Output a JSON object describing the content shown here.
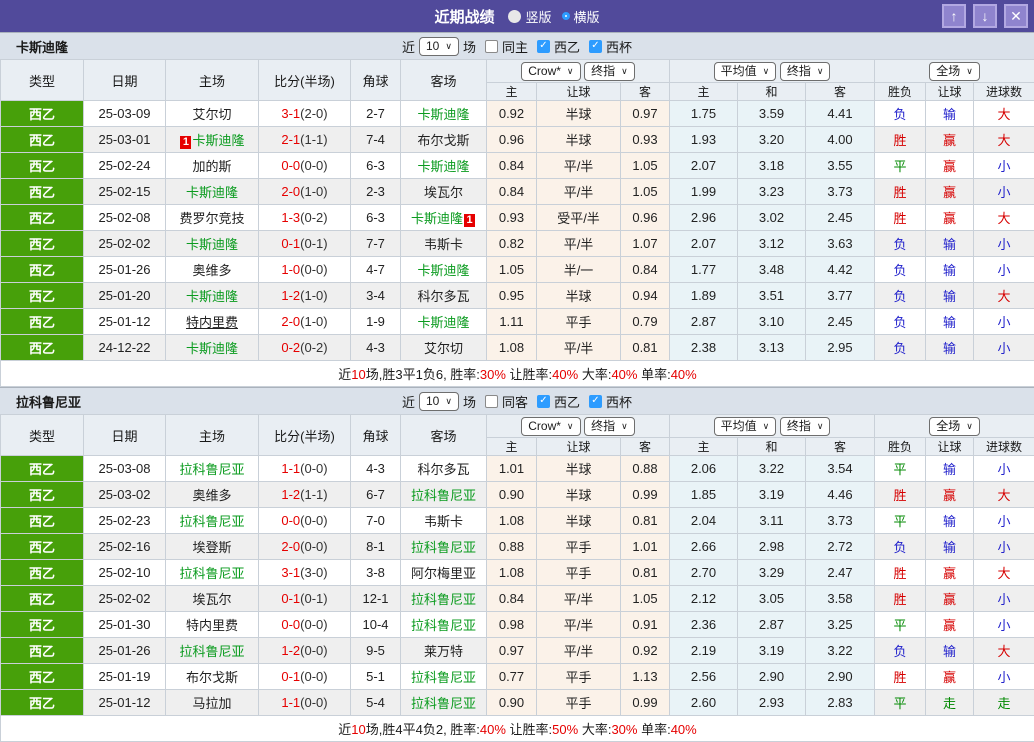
{
  "titlebar": {
    "title": "近期战绩",
    "vertical_label": "竖版",
    "horizontal_label": "横版",
    "up_icon": "↑",
    "down_icon": "↓",
    "close_icon": "✕",
    "bg_color": "#514A9B"
  },
  "dropdowns": {
    "source": "Crow*",
    "source_time": "终指",
    "avg": "平均值",
    "avg_time": "终指",
    "scope": "全场"
  },
  "table_columns": {
    "left": [
      "类型",
      "日期",
      "主场",
      "比分(半场)",
      "角球",
      "客场"
    ],
    "sub": [
      "主",
      "让球",
      "客",
      "主",
      "和",
      "客",
      "胜负",
      "让球",
      "进球数"
    ]
  },
  "result_colors": {
    "胜": "#D60000",
    "赢": "#D60000",
    "大": "#D60000",
    "负": "#2222CC",
    "输": "#2222CC",
    "小": "#2222CC",
    "平": "#008800",
    "走": "#008800"
  },
  "colors": {
    "league_green": "#47A00A",
    "team_green": "#0A9B1E",
    "score_red": "#E60000"
  },
  "sections": [
    {
      "team": "卡斯迪隆",
      "filter": {
        "prefix": "近",
        "count": "10",
        "suffix": "场",
        "checks": [
          {
            "label": "同主",
            "checked": false
          },
          {
            "label": "西乙",
            "checked": true
          },
          {
            "label": "西杯",
            "checked": true
          }
        ]
      },
      "rows": [
        {
          "type": "西乙",
          "date": "25-03-09",
          "home": {
            "name": "艾尔切"
          },
          "score": "3-1",
          "half": "(2-0)",
          "corner": "2-7",
          "away": {
            "name": "卡斯迪隆",
            "green": true
          },
          "odds": [
            "0.92",
            "半球",
            "0.97"
          ],
          "avg": [
            "1.75",
            "3.59",
            "4.41"
          ],
          "results": [
            "负",
            "输",
            "大"
          ]
        },
        {
          "type": "西乙",
          "date": "25-03-01",
          "home": {
            "name": "卡斯迪隆",
            "green": true,
            "badge": "1",
            "badge_pos": "before"
          },
          "score": "2-1",
          "half": "(1-1)",
          "corner": "7-4",
          "away": {
            "name": "布尔戈斯"
          },
          "odds": [
            "0.96",
            "半球",
            "0.93"
          ],
          "avg": [
            "1.93",
            "3.20",
            "4.00"
          ],
          "results": [
            "胜",
            "赢",
            "大"
          ]
        },
        {
          "type": "西乙",
          "date": "25-02-24",
          "home": {
            "name": "加的斯"
          },
          "score": "0-0",
          "half": "(0-0)",
          "corner": "6-3",
          "away": {
            "name": "卡斯迪隆",
            "green": true
          },
          "odds": [
            "0.84",
            "平/半",
            "1.05"
          ],
          "avg": [
            "2.07",
            "3.18",
            "3.55"
          ],
          "results": [
            "平",
            "赢",
            "小"
          ]
        },
        {
          "type": "西乙",
          "date": "25-02-15",
          "home": {
            "name": "卡斯迪隆",
            "green": true
          },
          "score": "2-0",
          "half": "(1-0)",
          "corner": "2-3",
          "away": {
            "name": "埃瓦尔"
          },
          "odds": [
            "0.84",
            "平/半",
            "1.05"
          ],
          "avg": [
            "1.99",
            "3.23",
            "3.73"
          ],
          "results": [
            "胜",
            "赢",
            "小"
          ]
        },
        {
          "type": "西乙",
          "date": "25-02-08",
          "home": {
            "name": "费罗尔竞技"
          },
          "score": "1-3",
          "half": "(0-2)",
          "corner": "6-3",
          "away": {
            "name": "卡斯迪隆",
            "green": true,
            "badge": "1",
            "badge_pos": "after"
          },
          "odds": [
            "0.93",
            "受平/半",
            "0.96"
          ],
          "avg": [
            "2.96",
            "3.02",
            "2.45"
          ],
          "results": [
            "胜",
            "赢",
            "大"
          ]
        },
        {
          "type": "西乙",
          "date": "25-02-02",
          "home": {
            "name": "卡斯迪隆",
            "green": true
          },
          "score": "0-1",
          "half": "(0-1)",
          "corner": "7-7",
          "away": {
            "name": "韦斯卡"
          },
          "odds": [
            "0.82",
            "平/半",
            "1.07"
          ],
          "avg": [
            "2.07",
            "3.12",
            "3.63"
          ],
          "results": [
            "负",
            "输",
            "小"
          ]
        },
        {
          "type": "西乙",
          "date": "25-01-26",
          "home": {
            "name": "奥维多"
          },
          "score": "1-0",
          "half": "(0-0)",
          "corner": "4-7",
          "away": {
            "name": "卡斯迪隆",
            "green": true
          },
          "odds": [
            "1.05",
            "半/一",
            "0.84"
          ],
          "avg": [
            "1.77",
            "3.48",
            "4.42"
          ],
          "results": [
            "负",
            "输",
            "小"
          ]
        },
        {
          "type": "西乙",
          "date": "25-01-20",
          "home": {
            "name": "卡斯迪隆",
            "green": true
          },
          "score": "1-2",
          "half": "(1-0)",
          "corner": "3-4",
          "away": {
            "name": "科尔多瓦"
          },
          "odds": [
            "0.95",
            "半球",
            "0.94"
          ],
          "avg": [
            "1.89",
            "3.51",
            "3.77"
          ],
          "results": [
            "负",
            "输",
            "大"
          ]
        },
        {
          "type": "西乙",
          "date": "25-01-12",
          "home": {
            "name": "特内里费",
            "underline": true
          },
          "score": "2-0",
          "half": "(1-0)",
          "corner": "1-9",
          "away": {
            "name": "卡斯迪隆",
            "green": true
          },
          "odds": [
            "1.11",
            "平手",
            "0.79"
          ],
          "avg": [
            "2.87",
            "3.10",
            "2.45"
          ],
          "results": [
            "负",
            "输",
            "小"
          ]
        },
        {
          "type": "西乙",
          "date": "24-12-22",
          "home": {
            "name": "卡斯迪隆",
            "green": true
          },
          "score": "0-2",
          "half": "(0-2)",
          "corner": "4-3",
          "away": {
            "name": "艾尔切"
          },
          "odds": [
            "1.08",
            "平/半",
            "0.81"
          ],
          "avg": [
            "2.38",
            "3.13",
            "2.95"
          ],
          "results": [
            "负",
            "输",
            "小"
          ]
        }
      ],
      "summary": [
        {
          "t": "近"
        },
        {
          "t": "10",
          "red": true
        },
        {
          "t": "场,胜3平1负6, 胜率:"
        },
        {
          "t": "30%",
          "red": true
        },
        {
          "t": " 让胜率:"
        },
        {
          "t": "40%",
          "red": true
        },
        {
          "t": " 大率:"
        },
        {
          "t": "40%",
          "red": true
        },
        {
          "t": " 单率:"
        },
        {
          "t": "40%",
          "red": true
        }
      ]
    },
    {
      "team": "拉科鲁尼亚",
      "filter": {
        "prefix": "近",
        "count": "10",
        "suffix": "场",
        "checks": [
          {
            "label": "同客",
            "checked": false
          },
          {
            "label": "西乙",
            "checked": true
          },
          {
            "label": "西杯",
            "checked": true
          }
        ]
      },
      "rows": [
        {
          "type": "西乙",
          "date": "25-03-08",
          "home": {
            "name": "拉科鲁尼亚",
            "green": true
          },
          "score": "1-1",
          "half": "(0-0)",
          "corner": "4-3",
          "away": {
            "name": "科尔多瓦"
          },
          "odds": [
            "1.01",
            "半球",
            "0.88"
          ],
          "avg": [
            "2.06",
            "3.22",
            "3.54"
          ],
          "results": [
            "平",
            "输",
            "小"
          ]
        },
        {
          "type": "西乙",
          "date": "25-03-02",
          "home": {
            "name": "奥维多"
          },
          "score": "1-2",
          "half": "(1-1)",
          "corner": "6-7",
          "away": {
            "name": "拉科鲁尼亚",
            "green": true
          },
          "odds": [
            "0.90",
            "半球",
            "0.99"
          ],
          "avg": [
            "1.85",
            "3.19",
            "4.46"
          ],
          "results": [
            "胜",
            "赢",
            "大"
          ]
        },
        {
          "type": "西乙",
          "date": "25-02-23",
          "home": {
            "name": "拉科鲁尼亚",
            "green": true
          },
          "score": "0-0",
          "half": "(0-0)",
          "corner": "7-0",
          "away": {
            "name": "韦斯卡"
          },
          "odds": [
            "1.08",
            "半球",
            "0.81"
          ],
          "avg": [
            "2.04",
            "3.11",
            "3.73"
          ],
          "results": [
            "平",
            "输",
            "小"
          ]
        },
        {
          "type": "西乙",
          "date": "25-02-16",
          "home": {
            "name": "埃登斯"
          },
          "score": "2-0",
          "half": "(0-0)",
          "corner": "8-1",
          "away": {
            "name": "拉科鲁尼亚",
            "green": true
          },
          "odds": [
            "0.88",
            "平手",
            "1.01"
          ],
          "avg": [
            "2.66",
            "2.98",
            "2.72"
          ],
          "results": [
            "负",
            "输",
            "小"
          ]
        },
        {
          "type": "西乙",
          "date": "25-02-10",
          "home": {
            "name": "拉科鲁尼亚",
            "green": true
          },
          "score": "3-1",
          "half": "(3-0)",
          "corner": "3-8",
          "away": {
            "name": "阿尔梅里亚"
          },
          "odds": [
            "1.08",
            "平手",
            "0.81"
          ],
          "avg": [
            "2.70",
            "3.29",
            "2.47"
          ],
          "results": [
            "胜",
            "赢",
            "大"
          ]
        },
        {
          "type": "西乙",
          "date": "25-02-02",
          "home": {
            "name": "埃瓦尔"
          },
          "score": "0-1",
          "half": "(0-1)",
          "corner": "12-1",
          "away": {
            "name": "拉科鲁尼亚",
            "green": true
          },
          "odds": [
            "0.84",
            "平/半",
            "1.05"
          ],
          "avg": [
            "2.12",
            "3.05",
            "3.58"
          ],
          "results": [
            "胜",
            "赢",
            "小"
          ]
        },
        {
          "type": "西乙",
          "date": "25-01-30",
          "home": {
            "name": "特内里费"
          },
          "score": "0-0",
          "half": "(0-0)",
          "corner": "10-4",
          "away": {
            "name": "拉科鲁尼亚",
            "green": true
          },
          "odds": [
            "0.98",
            "平/半",
            "0.91"
          ],
          "avg": [
            "2.36",
            "2.87",
            "3.25"
          ],
          "results": [
            "平",
            "赢",
            "小"
          ]
        },
        {
          "type": "西乙",
          "date": "25-01-26",
          "home": {
            "name": "拉科鲁尼亚",
            "green": true
          },
          "score": "1-2",
          "half": "(0-0)",
          "corner": "9-5",
          "away": {
            "name": "莱万特"
          },
          "odds": [
            "0.97",
            "平/半",
            "0.92"
          ],
          "avg": [
            "2.19",
            "3.19",
            "3.22"
          ],
          "results": [
            "负",
            "输",
            "大"
          ]
        },
        {
          "type": "西乙",
          "date": "25-01-19",
          "home": {
            "name": "布尔戈斯"
          },
          "score": "0-1",
          "half": "(0-0)",
          "corner": "5-1",
          "away": {
            "name": "拉科鲁尼亚",
            "green": true
          },
          "odds": [
            "0.77",
            "平手",
            "1.13"
          ],
          "avg": [
            "2.56",
            "2.90",
            "2.90"
          ],
          "results": [
            "胜",
            "赢",
            "小"
          ]
        },
        {
          "type": "西乙",
          "date": "25-01-12",
          "home": {
            "name": "马拉加"
          },
          "score": "1-1",
          "half": "(0-0)",
          "corner": "5-4",
          "away": {
            "name": "拉科鲁尼亚",
            "green": true
          },
          "odds": [
            "0.90",
            "平手",
            "0.99"
          ],
          "avg": [
            "2.60",
            "2.93",
            "2.83"
          ],
          "results": [
            "平",
            "走",
            "走"
          ]
        }
      ],
      "summary": [
        {
          "t": "近"
        },
        {
          "t": "10",
          "red": true
        },
        {
          "t": "场,胜4平4负2, 胜率:"
        },
        {
          "t": "40%",
          "red": true
        },
        {
          "t": " 让胜率:"
        },
        {
          "t": "50%",
          "red": true
        },
        {
          "t": " 大率:"
        },
        {
          "t": "30%",
          "red": true
        },
        {
          "t": " 单率:"
        },
        {
          "t": "40%",
          "red": true
        }
      ]
    }
  ]
}
